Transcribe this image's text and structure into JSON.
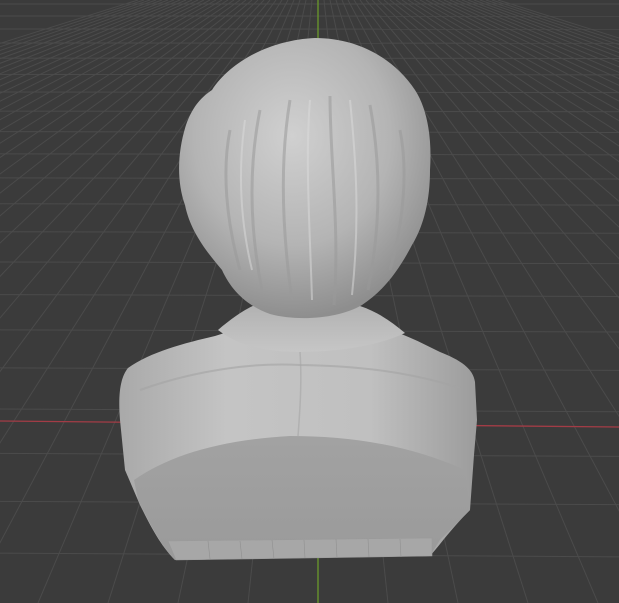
{
  "viewport": {
    "mode": "3d-viewport",
    "object": "bust-sculpt",
    "view": "back",
    "shading": "solid"
  },
  "colors": {
    "background": "#3b3b3b",
    "grid_line": "#4a4a4a",
    "x_axis": "#a33c46",
    "y_axis": "#6a9a2a",
    "mesh_base": "#b8b8b8",
    "mesh_shadow": "#8f8f8f",
    "mesh_highlight": "#d2d2d2"
  },
  "icons": {
    "axis_x": "x-axis-line",
    "axis_y": "y-axis-line"
  }
}
